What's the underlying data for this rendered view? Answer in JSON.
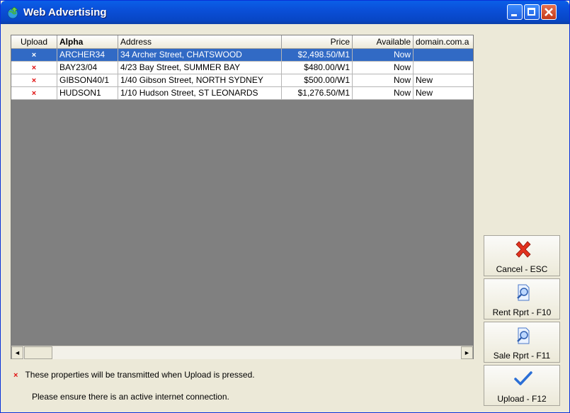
{
  "window": {
    "title": "Web Advertising"
  },
  "grid": {
    "columns": [
      "Upload",
      "Alpha",
      "Address",
      "Price",
      "Available",
      "domain.com.a"
    ],
    "rows": [
      {
        "upload": "×",
        "alpha": "ARCHER34",
        "address": "34 Archer Street, CHATSWOOD",
        "price": "$2,498.50/M1",
        "available": "Now",
        "domain": ""
      },
      {
        "upload": "×",
        "alpha": "BAY23/04",
        "address": "4/23 Bay Street, SUMMER BAY",
        "price": "$480.00/W1",
        "available": "Now",
        "domain": ""
      },
      {
        "upload": "×",
        "alpha": "GIBSON40/1",
        "address": "1/40 Gibson Street, NORTH SYDNEY",
        "price": "$500.00/W1",
        "available": "Now",
        "domain": "New"
      },
      {
        "upload": "×",
        "alpha": "HUDSON1",
        "address": "1/10 Hudson Street, ST LEONARDS",
        "price": "$1,276.50/M1",
        "available": "Now",
        "domain": "New"
      }
    ]
  },
  "notes": {
    "marker": "×",
    "line1": "These properties will be transmitted when Upload is pressed.",
    "line2": "Please ensure there is an active internet connection."
  },
  "buttons": {
    "cancel": "Cancel - ESC",
    "rent": "Rent Rprt - F10",
    "sale": "Sale Rprt - F11",
    "upload": "Upload - F12"
  },
  "scroll": {
    "left_arrow": "◄",
    "right_arrow": "►"
  },
  "colors": {
    "selection": "#316ac5",
    "mark": "#e01010",
    "grid_bg": "#808080"
  }
}
